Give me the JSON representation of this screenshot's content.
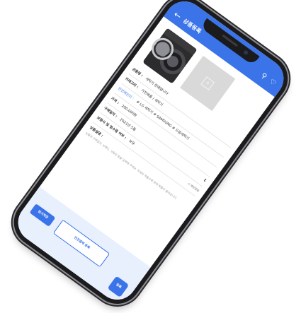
{
  "header": {
    "back_icon": "arrow-left-icon",
    "title": "상품등록",
    "search_icon": "search-icon",
    "favorite_icon": "heart-icon"
  },
  "photos": {
    "main_alt_icon": "washing-machine-image",
    "add_icon": "plus-icon"
  },
  "form": {
    "product_name_label": "상품명 :",
    "product_name_value": "세탁기 판매합니다",
    "category_label": "카테고리 :",
    "category_value": "가전제품 / 세탁기",
    "safety_label": "안전레인지 :",
    "safety_value": "# LG 세탁기 # SAMSUNG # 드럼세탁기",
    "price_label": "가격 :",
    "price_value": "200,000원",
    "purchase_date_label": "구매일자 :",
    "purchase_date_value": "2021년 5월",
    "warranty_label": "보증서 및 영수증 여부 :",
    "warranty_value": "보유",
    "warranty_option": "해당없음",
    "description_label": "상품설명 :",
    "description_hint": "상품의 구매일자, 브랜드, 사용감 등을 입력해 주세요. 자세히 적을수록 판매 확률이 올라갑니다."
  },
  "actions": {
    "temp_save": "임시저장",
    "safe_trade": "안전결제 등록",
    "register": "등록"
  },
  "colors": {
    "primary": "#3b74e8",
    "bottom_bg": "#e8f0fd"
  }
}
